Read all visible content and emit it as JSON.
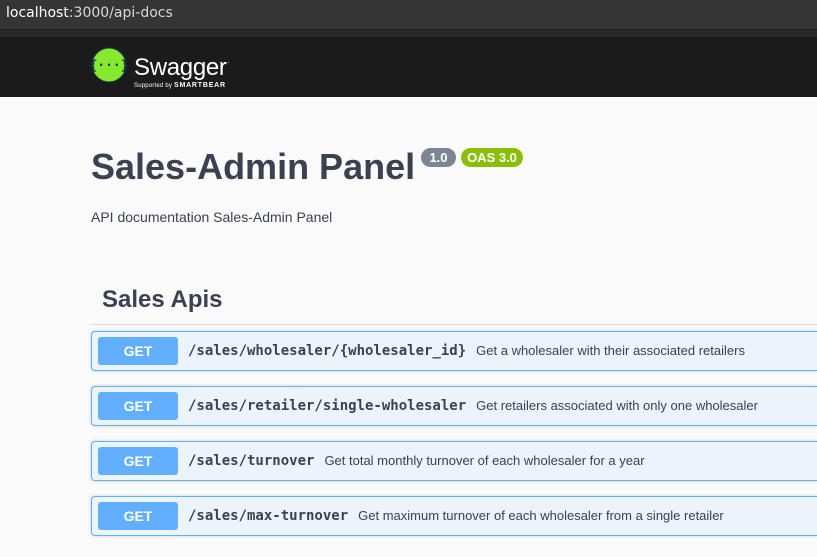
{
  "browser": {
    "url_host": "localhost",
    "url_rest": ":3000/api-docs"
  },
  "header": {
    "logo_icon": "swagger-logo-icon",
    "logo_text": "Swagger",
    "logo_trademark": ".",
    "logo_supported": "Supported by",
    "logo_company": "SMARTBEAR"
  },
  "info": {
    "title": "Sales-Admin Panel",
    "version": "1.0",
    "oas": "OAS 3.0",
    "description": "API documentation Sales-Admin Panel"
  },
  "tag": {
    "name": "Sales Apis"
  },
  "operations": [
    {
      "method": "GET",
      "path": "/sales/wholesaler/{wholesaler_id}",
      "summary": "Get a wholesaler with their associated retailers"
    },
    {
      "method": "GET",
      "path": "/sales/retailer/single-wholesaler",
      "summary": "Get retailers associated with only one wholesaler"
    },
    {
      "method": "GET",
      "path": "/sales/turnover",
      "summary": "Get total monthly turnover of each wholesaler for a year"
    },
    {
      "method": "GET",
      "path": "/sales/max-turnover",
      "summary": "Get maximum turnover of each wholesaler from a single retailer"
    }
  ],
  "colors": {
    "get_accent": "#61affe",
    "get_background": "#ebf3fb",
    "oas_badge": "#89bf04",
    "version_badge": "#7d8492",
    "topbar": "#1b1b1b"
  }
}
